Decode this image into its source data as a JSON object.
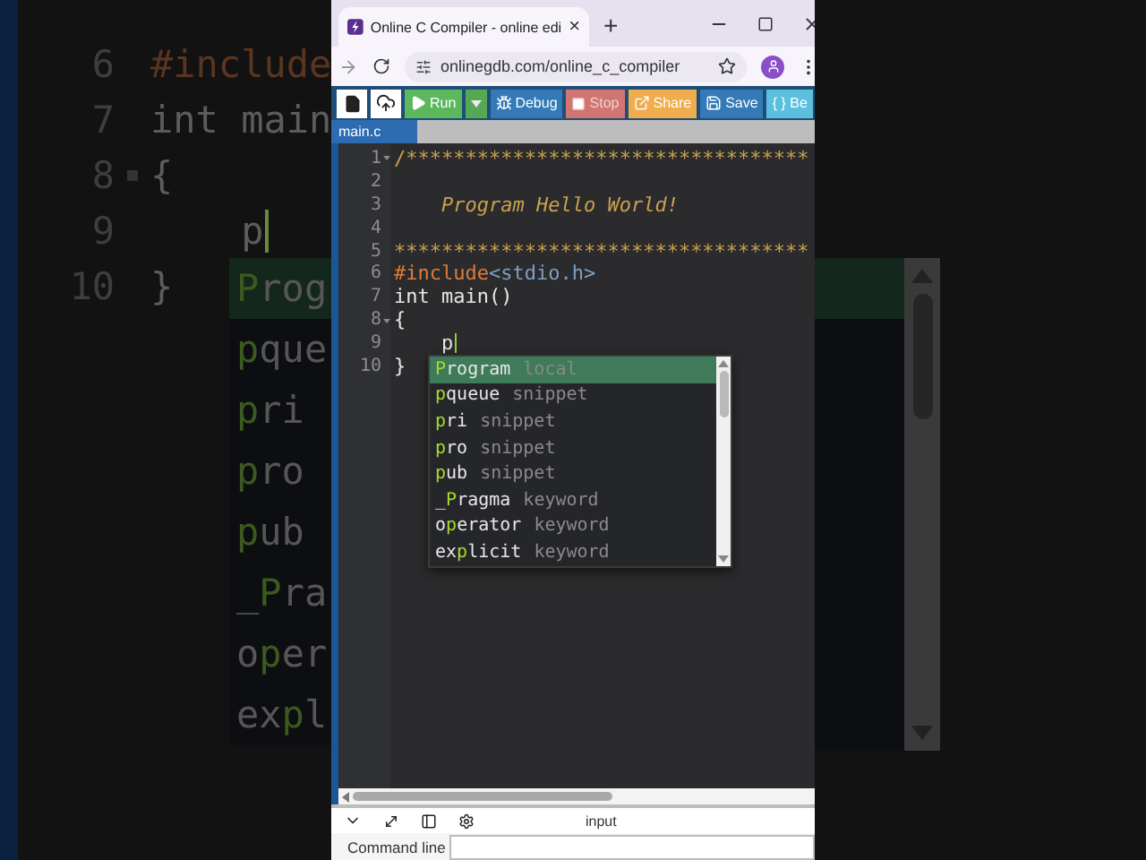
{
  "backdrop": {
    "code_lines": [
      {
        "number": "6",
        "fold": false,
        "cursor": false,
        "tokens": [
          {
            "text": "#include",
            "kind": "directive"
          }
        ]
      },
      {
        "number": "7",
        "fold": false,
        "cursor": false,
        "tokens": [
          {
            "text": "int main",
            "kind": "plain"
          }
        ]
      },
      {
        "number": "8",
        "fold": true,
        "cursor": false,
        "tokens": [
          {
            "text": "{",
            "kind": "plain"
          }
        ]
      },
      {
        "number": "9",
        "fold": false,
        "cursor": true,
        "tokens": [
          {
            "text": "    p",
            "kind": "plain"
          }
        ]
      },
      {
        "number": "10",
        "fold": false,
        "cursor": false,
        "tokens": [
          {
            "text": "}",
            "kind": "plain"
          }
        ]
      }
    ],
    "completions": [
      {
        "match": "P",
        "after": "rog",
        "selected": true
      },
      {
        "match": "p",
        "after": "que",
        "selected": false
      },
      {
        "match": "p",
        "after": "ri",
        "selected": false
      },
      {
        "match": "p",
        "after": "ro",
        "selected": false
      },
      {
        "match": "p",
        "after": "ub",
        "selected": false
      },
      {
        "before": "_",
        "match": "P",
        "after": "ra",
        "selected": false
      },
      {
        "before": "o",
        "match": "p",
        "after": "er",
        "selected": false
      },
      {
        "before": "ex",
        "match": "p",
        "after": "l",
        "selected": false
      }
    ]
  },
  "browser": {
    "tab": {
      "title": "Online C Compiler - online edi",
      "close": "×"
    },
    "new_tab": "+",
    "address": {
      "url": "onlinegdb.com/online_c_compiler"
    }
  },
  "toolbar": {
    "buttons": [
      {
        "kind": "new-file"
      },
      {
        "kind": "upload"
      },
      {
        "kind": "run",
        "label": "Run",
        "color": "#5cb85c",
        "disabled": false
      },
      {
        "kind": "debug",
        "label": "Debug",
        "color": "#337ab7",
        "disabled": false
      },
      {
        "kind": "stop",
        "label": "Stop",
        "color": "#d27572",
        "disabled": true
      },
      {
        "kind": "share",
        "label": "Share",
        "color": "#f0ad4e",
        "disabled": false
      },
      {
        "kind": "save",
        "label": "Save",
        "color": "#337ab7",
        "disabled": false
      },
      {
        "kind": "beautify",
        "label": "{ } Be",
        "color": "#5bc0de",
        "disabled": false
      }
    ]
  },
  "editor": {
    "file_tabs": [
      {
        "label": "main.c",
        "selected": true
      }
    ],
    "lines": [
      {
        "number": "1",
        "fold": true,
        "cursor": false,
        "tokens": [
          {
            "text": "/**********************************",
            "kind": "comment"
          }
        ]
      },
      {
        "number": "2",
        "fold": false,
        "cursor": false
      },
      {
        "number": "3",
        "fold": false,
        "cursor": false,
        "tokens": [
          {
            "text": "    Program Hello World!",
            "kind": "comment-italic"
          }
        ]
      },
      {
        "number": "4",
        "fold": false,
        "cursor": false
      },
      {
        "number": "5",
        "fold": false,
        "cursor": false,
        "tokens": [
          {
            "text": "***********************************",
            "kind": "comment"
          }
        ]
      },
      {
        "number": "6",
        "fold": false,
        "cursor": false,
        "tokens": [
          {
            "text": "#include",
            "kind": "directive"
          },
          {
            "text": "<stdio.h>",
            "kind": "header"
          }
        ]
      },
      {
        "number": "7",
        "fold": false,
        "cursor": false,
        "tokens": [
          {
            "text": "int main()",
            "kind": "plain"
          }
        ]
      },
      {
        "number": "8",
        "fold": true,
        "cursor": false,
        "tokens": [
          {
            "text": "{",
            "kind": "plain"
          }
        ]
      },
      {
        "number": "9",
        "fold": false,
        "cursor": true,
        "tokens": [
          {
            "text": "    p",
            "kind": "plain"
          }
        ]
      },
      {
        "number": "10",
        "fold": false,
        "cursor": false,
        "tokens": [
          {
            "text": "}",
            "kind": "plain"
          }
        ]
      }
    ],
    "completions": [
      {
        "match": "P",
        "after": "rogram",
        "type": "local",
        "selected": true
      },
      {
        "match": "p",
        "after": "queue",
        "type": "snippet",
        "selected": false
      },
      {
        "match": "p",
        "after": "ri",
        "type": "snippet",
        "selected": false
      },
      {
        "match": "p",
        "after": "ro",
        "type": "snippet",
        "selected": false
      },
      {
        "match": "p",
        "after": "ub",
        "type": "snippet",
        "selected": false
      },
      {
        "before": "_",
        "match": "P",
        "after": "ragma",
        "type": "keyword",
        "selected": false
      },
      {
        "before": "o",
        "match": "p",
        "after": "erator",
        "type": "keyword",
        "selected": false
      },
      {
        "before": "ex",
        "match": "p",
        "after": "licit",
        "type": "keyword",
        "selected": false
      }
    ]
  },
  "io_panel": {
    "title": "input",
    "command_line": {
      "label": "Command line"
    }
  }
}
